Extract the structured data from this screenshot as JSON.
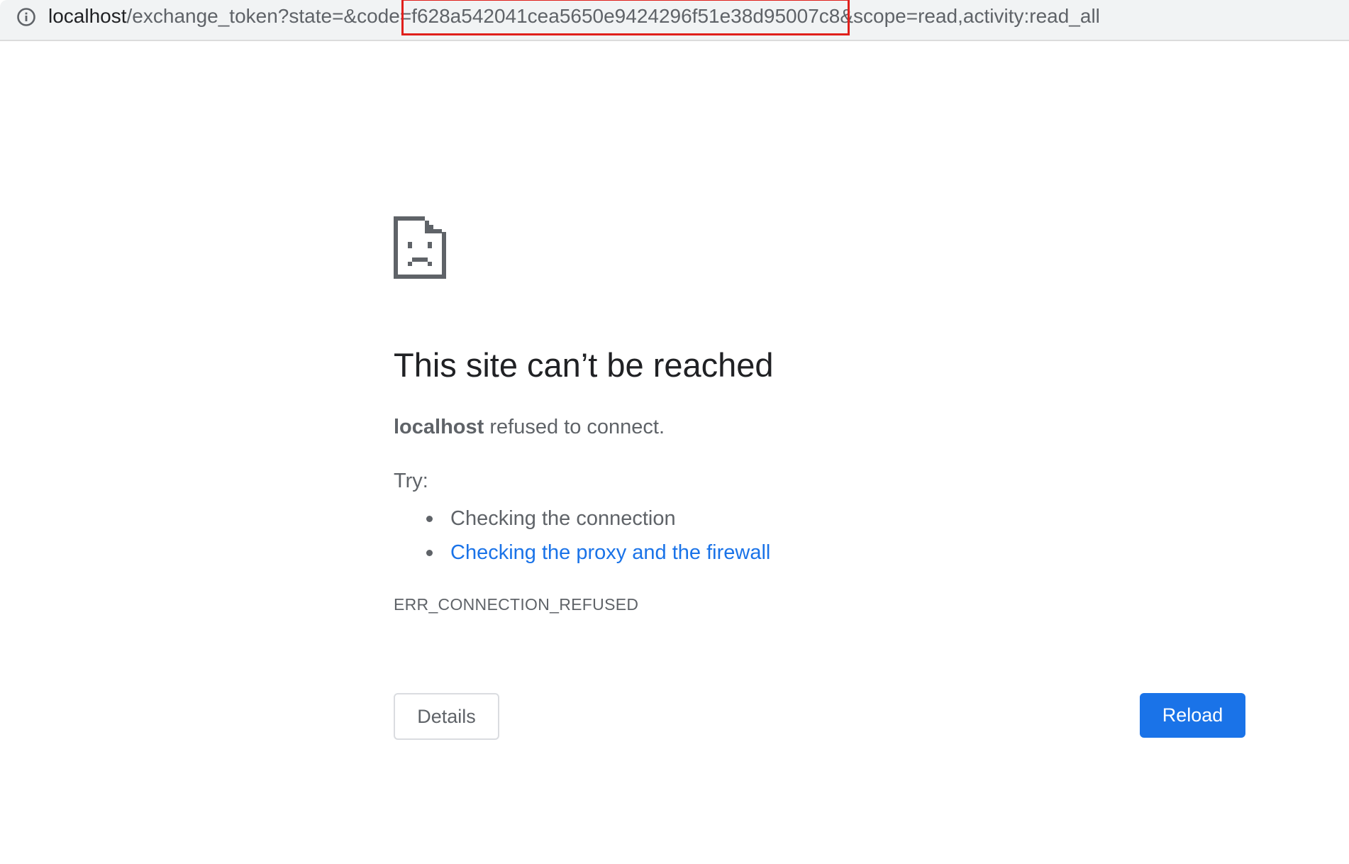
{
  "address_bar": {
    "host": "localhost",
    "path_before_code": "/exchange_token?state=&code=",
    "code": "f628a542041cea5650e9424296f51e38d95007c8",
    "path_after_code": "&scope=read,activity:read_all",
    "icon": "info-icon",
    "highlight_color": "#e0201c"
  },
  "error_page": {
    "icon": "sad-page-icon",
    "title": "This site can’t be reached",
    "summary_host": "localhost",
    "summary_text": " refused to connect.",
    "try_label": "Try:",
    "suggestions": [
      {
        "label": "Checking the connection",
        "is_link": false
      },
      {
        "label": "Checking the proxy and the firewall",
        "is_link": true
      }
    ],
    "error_code": "ERR_CONNECTION_REFUSED"
  },
  "buttons": {
    "details_label": "Details",
    "reload_label": "Reload"
  },
  "colors": {
    "accent": "#1a73e8",
    "text_secondary": "#5f6368",
    "text_primary": "#202124"
  }
}
